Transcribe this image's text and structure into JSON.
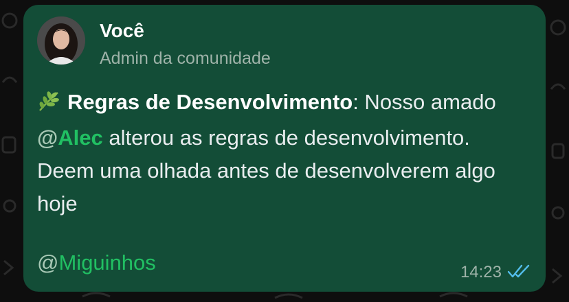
{
  "sender": {
    "name": "Você",
    "role": "Admin da comunidade"
  },
  "message": {
    "emoji_icon": "herb-leaf-icon",
    "title": "Regras de Desenvolvimento",
    "after_title": ": Nosso amado ",
    "mention1_at": "@",
    "mention1_name": "Alec",
    "body": " alterou as regras de desenvolvimento. Deem uma olhada antes de desenvolverem algo hoje",
    "mention2_at": "@",
    "mention2_name": "Miguinhos"
  },
  "meta": {
    "time": "14:23",
    "status_icon": "double-check-read-icon"
  },
  "colors": {
    "bubble": "#134d37",
    "mention": "#21c063",
    "read_ticks": "#53bdeb"
  }
}
